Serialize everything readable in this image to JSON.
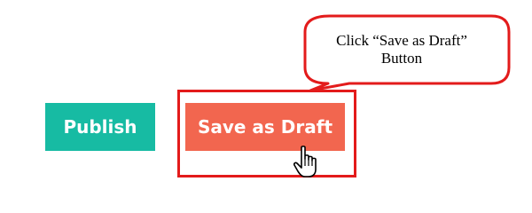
{
  "buttons": {
    "publish_label": "Publish",
    "save_draft_label": "Save as Draft"
  },
  "callout": {
    "line1": "Click “Save as Draft”",
    "line2": "Button"
  },
  "colors": {
    "publish_bg": "#17bba3",
    "save_draft_bg": "#f2664f",
    "highlight": "#e31b1b",
    "button_text": "#ffffff"
  },
  "icons": {
    "cursor": "hand-pointer-icon"
  }
}
